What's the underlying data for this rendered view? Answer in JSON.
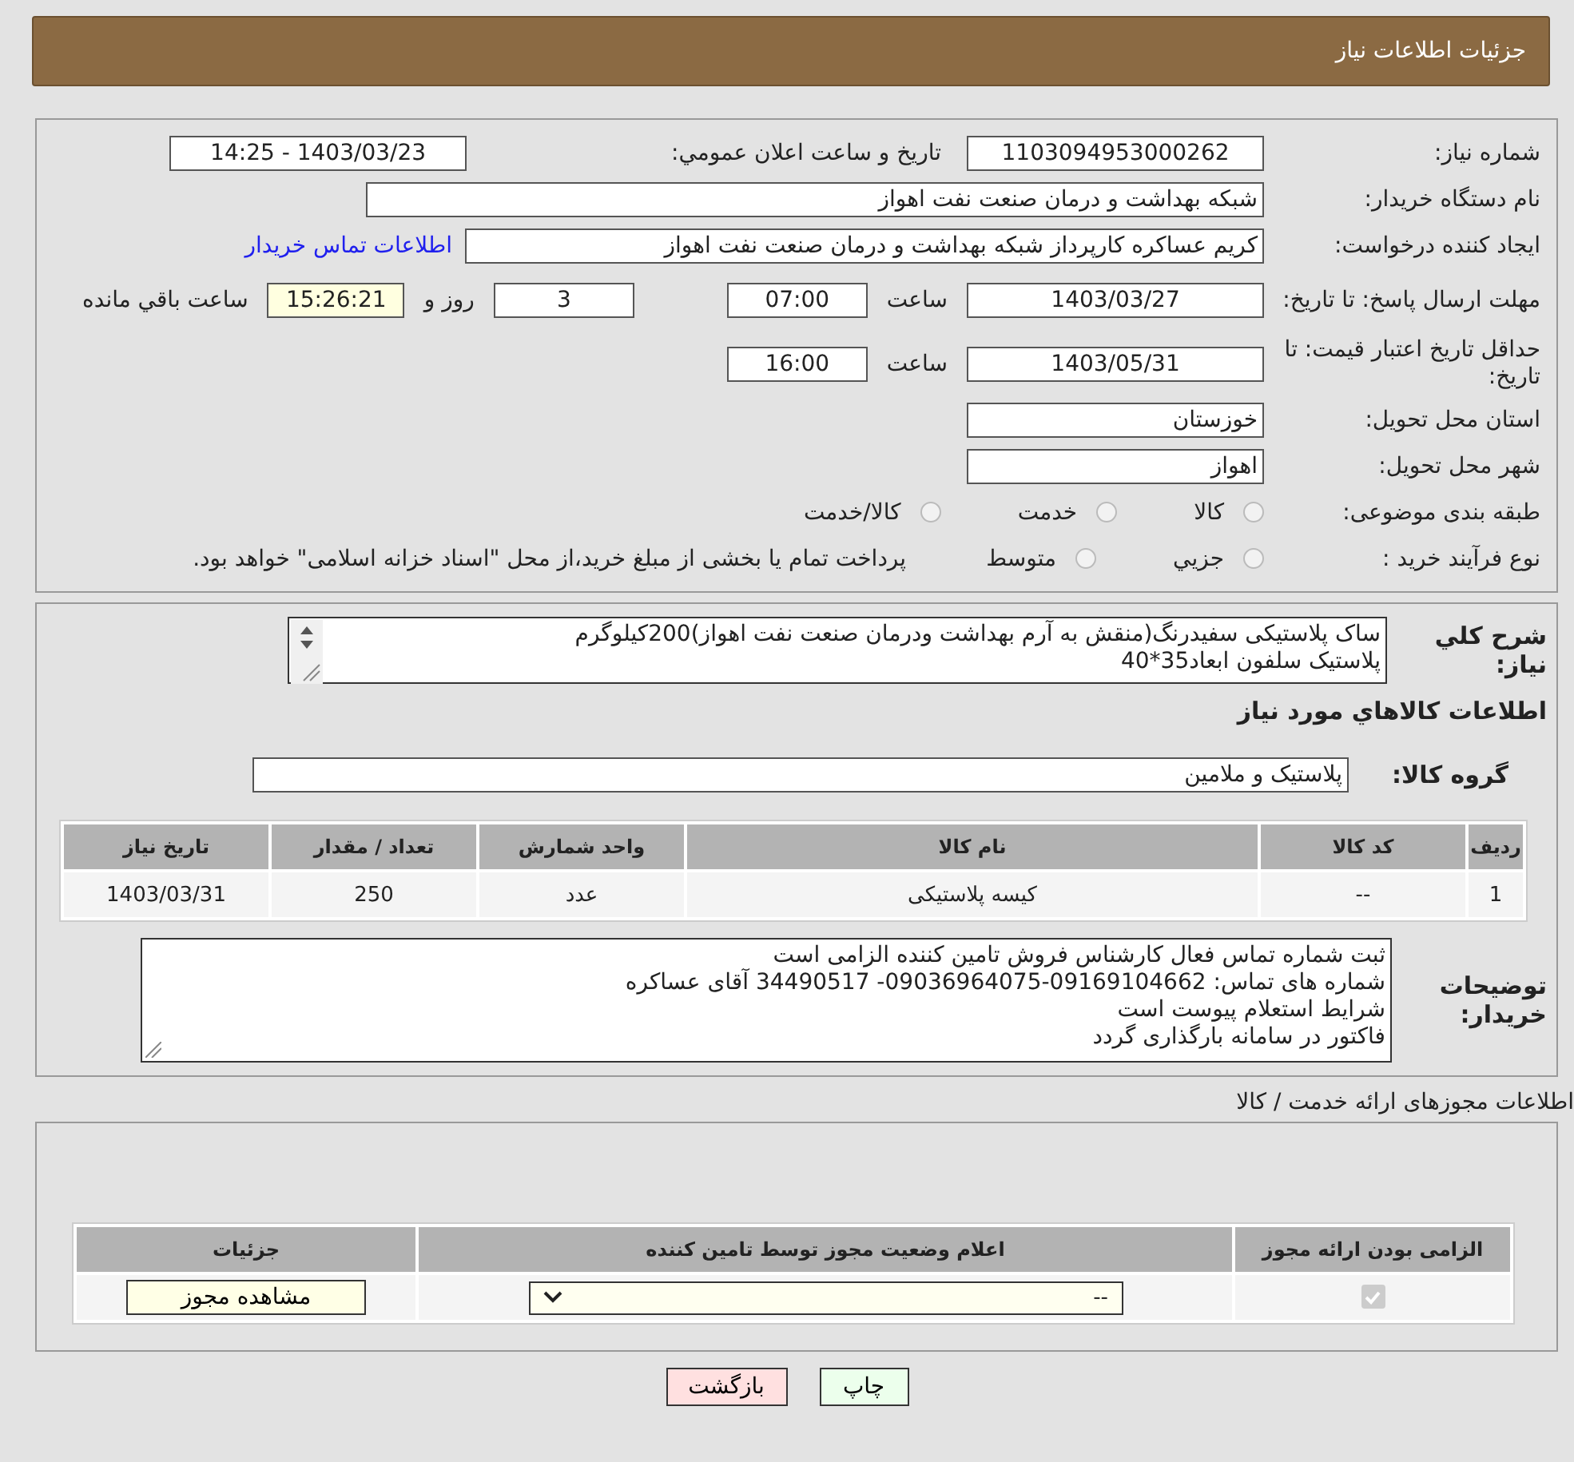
{
  "header": {
    "title": "جزئیات اطلاعات نیاز"
  },
  "details": {
    "need_number": {
      "label": "شماره نیاز:",
      "value": "1103094953000262"
    },
    "announce": {
      "label": "تاریخ و ساعت اعلان عمومي:",
      "value": "1403/03/23 - 14:25"
    },
    "buyer_org": {
      "label": "نام دستگاه خریدار:",
      "value": "شبکه بهداشت و درمان صنعت نفت اهواز"
    },
    "requester": {
      "label": "ایجاد کننده درخواست:",
      "value": "کریم عساکره کارپرداز شبکه بهداشت و درمان صنعت نفت اهواز",
      "link": "اطلاعات تماس خریدار"
    },
    "reply_deadline": {
      "label": "مهلت ارسال پاسخ: تا تاریخ:",
      "date": "1403/03/27",
      "time_label": "ساعت",
      "time": "07:00",
      "days": "3",
      "days_label": "روز و",
      "remaining": "15:26:21",
      "remaining_label": "ساعت باقي مانده"
    },
    "price_validity": {
      "label": "حداقل تاریخ اعتبار قیمت: تا تاریخ:",
      "date": "1403/05/31",
      "time_label": "ساعت",
      "time": "16:00"
    },
    "province": {
      "label": "استان محل تحویل:",
      "value": "خوزستان"
    },
    "city": {
      "label": "شهر محل تحویل:",
      "value": "اهواز"
    },
    "category": {
      "label": "طبقه بندی موضوعی:",
      "options": [
        {
          "label": "کالا",
          "selected": false
        },
        {
          "label": "خدمت",
          "selected": false
        },
        {
          "label": "کالا/خدمت",
          "selected": false
        }
      ]
    },
    "purchase_type": {
      "label": "نوع فرآیند خرید :",
      "options": [
        {
          "label": "جزيي",
          "selected": false
        },
        {
          "label": "متوسط",
          "selected": false
        }
      ],
      "note": "پرداخت تمام یا بخشی از مبلغ خرید،از محل \"اسناد خزانه اسلامی\" خواهد بود."
    }
  },
  "summary": {
    "label": "شرح كلي نياز:",
    "lines": [
      "ساک پلاستیکی سفیدرنگ(منقش به آرم بهداشت ودرمان صنعت نفت  اهواز)200کیلوگرم",
      "پلاستیک سلفون ابعاد35*40"
    ],
    "goods_title": "اطلاعات كالاهاي مورد نياز",
    "group_label": "گروه کالا:",
    "group_value": "پلاستیک و ملامین",
    "table": {
      "columns": [
        "ردیف",
        "کد کالا",
        "نام کالا",
        "واحد شمارش",
        "تعداد / مقدار",
        "تاریخ نیاز"
      ],
      "rows": [
        [
          "1",
          "--",
          "کیسه پلاستیکی",
          "عدد",
          "250",
          "1403/03/31"
        ]
      ]
    },
    "notes_label": "توضیحات خریدار:",
    "notes": [
      "ثبت شماره تماس فعال کارشناس فروش تامین کننده الزامی است",
      "شماره های تماس: 09169104662-09036964075- 34490517 آقای عساکره",
      "شرایط استعلام پیوست است",
      "فاکتور در سامانه بارگذاری گردد"
    ]
  },
  "licenses": {
    "title": "اطلاعات مجوزهای ارائه خدمت / کالا",
    "columns": [
      "الزامی بودن ارائه مجوز",
      "اعلام وضعیت مجوز توسط تامین کننده",
      "جزئیات"
    ],
    "rows": [
      {
        "required": true,
        "status": "--",
        "action": "مشاهده مجوز"
      }
    ]
  },
  "buttons": {
    "back": "بازگشت",
    "print": "چاپ"
  }
}
